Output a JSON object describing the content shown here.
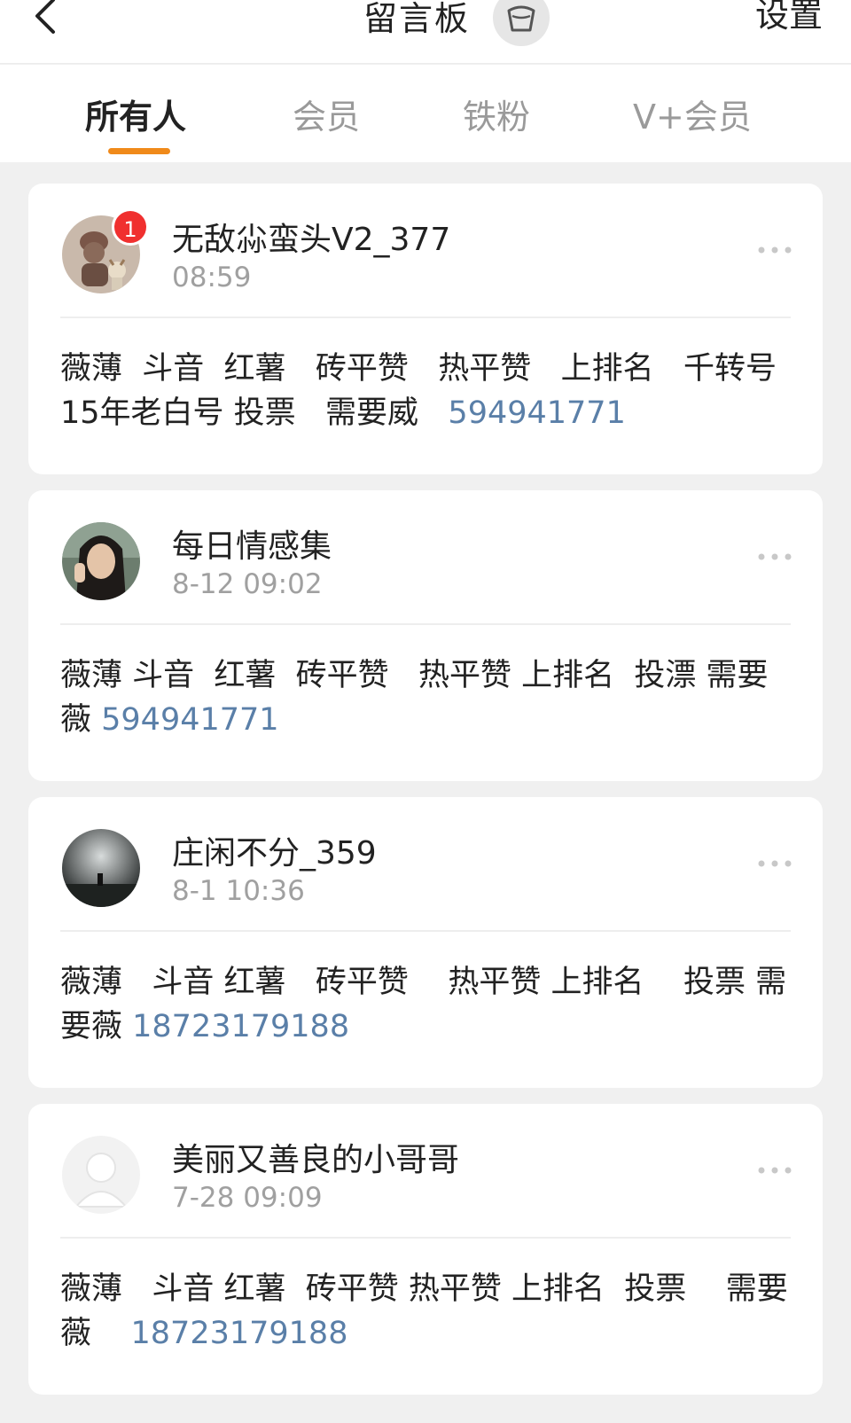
{
  "header": {
    "title": "留言板",
    "settings_label": "设置",
    "icons": {
      "back": "chevron-left-icon",
      "mascot": "pudding-mascot-icon"
    }
  },
  "tabs": [
    {
      "label": "所有人",
      "active": true
    },
    {
      "label": "会员",
      "active": false
    },
    {
      "label": "铁粉",
      "active": false
    },
    {
      "label": "V+会员",
      "active": false
    }
  ],
  "colors": {
    "accent": "#f08a1a",
    "link": "#5a7fa8",
    "badge": "#f0302f"
  },
  "messages": [
    {
      "username": "无敌尛蛮头V2_377",
      "time": "08:59",
      "badge": "1",
      "text": "薇薄  斗音  红薯   砖平赞   热平赞   上排名   千转号 15年老白号 投票   需要威   ",
      "contact": "594941771",
      "avatar": "cartoon-avatar"
    },
    {
      "username": "每日情感集",
      "time": "8-12 09:02",
      "text": "薇薄 斗音  红薯  砖平赞   热平赞 上排名  投漂 需要薇 ",
      "contact": "594941771",
      "avatar": "photo-avatar-woman"
    },
    {
      "username": "庄闲不分_359",
      "time": "8-1 10:36",
      "text": "薇薄   斗音 红薯   砖平赞    热平赞 上排名    投票 需要薇 ",
      "contact": "18723179188",
      "avatar": "photo-avatar-landscape"
    },
    {
      "username": "美丽又善良的小哥哥",
      "time": "7-28 09:09",
      "text": "薇薄   斗音 红薯  砖平赞 热平赞 上排名  投票    需要薇    ",
      "contact": "18723179188",
      "avatar": "default-avatar"
    }
  ]
}
